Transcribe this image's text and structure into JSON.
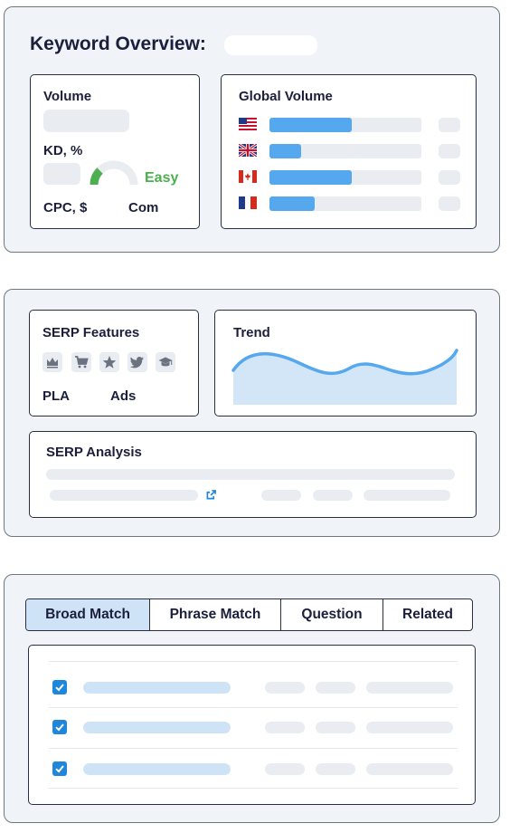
{
  "overview": {
    "title": "Keyword Overview:",
    "volume_label": "Volume",
    "kd_label": "KD, %",
    "difficulty_text": "Easy",
    "difficulty_color": "#4caf50",
    "cpc_label": "CPC, $",
    "com_label": "Com",
    "global_volume_label": "Global Volume",
    "countries": [
      {
        "flag": "us-flag-icon",
        "fill": 0.54
      },
      {
        "flag": "uk-flag-icon",
        "fill": 0.21
      },
      {
        "flag": "ca-flag-icon",
        "fill": 0.54
      },
      {
        "flag": "fr-flag-icon",
        "fill": 0.3
      }
    ]
  },
  "serp": {
    "features_label": "SERP Features",
    "feature_icons": [
      "crown-icon",
      "cart-icon",
      "star-icon",
      "twitter-icon",
      "graduation-cap-icon"
    ],
    "pla_label": "PLA",
    "ads_label": "Ads",
    "trend_label": "Trend",
    "analysis_label": "SERP Analysis"
  },
  "keywords": {
    "tabs": [
      "Broad Match",
      "Phrase Match",
      "Question",
      "Related"
    ],
    "active_tab": 0,
    "rows_checked": [
      true,
      true,
      true
    ]
  },
  "colors": {
    "accent_blue": "#55a8ee",
    "checkbox_blue": "#1f86d9",
    "active_tab_bg": "#cfe3f7"
  }
}
